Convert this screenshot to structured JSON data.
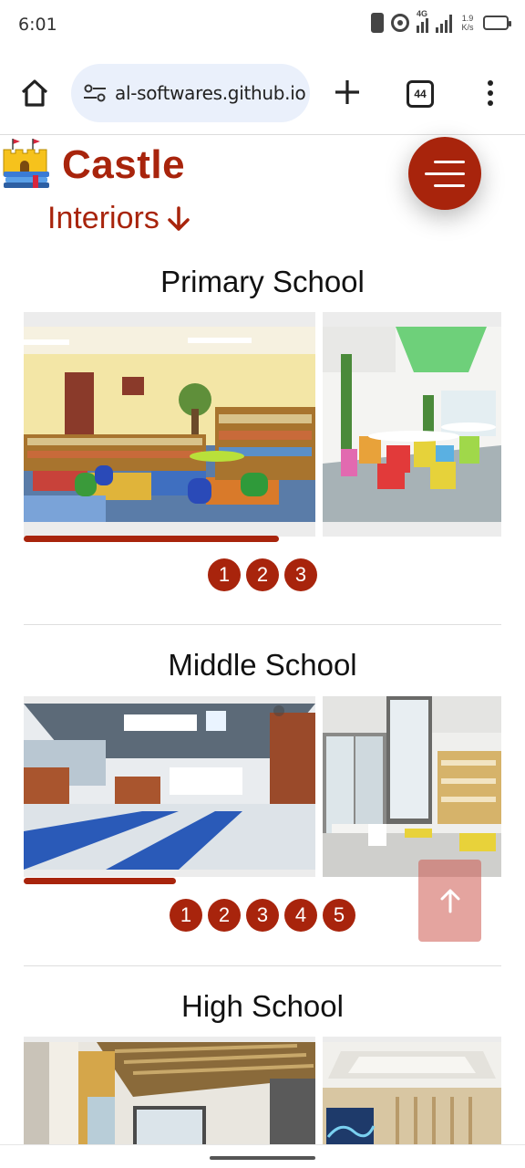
{
  "status_bar": {
    "time": "6:01",
    "network": "4G",
    "speed": "1.9 K/s"
  },
  "browser": {
    "url": "al-softwares.github.io",
    "tab_count": "44",
    "icons": [
      "home-icon",
      "site-settings-icon",
      "new-tab-icon",
      "tab-switcher-icon",
      "more-menu-icon"
    ]
  },
  "header": {
    "brand": "Castle",
    "tagline": "Interiors",
    "accent_color": "#a8240c",
    "icons": [
      "castle-logo-icon",
      "arrow-down-icon",
      "hamburger-menu-icon"
    ]
  },
  "sections": [
    {
      "title": "Primary School",
      "pages": [
        "1",
        "2",
        "3"
      ],
      "progress": 0.87,
      "images": [
        "classroom-library-image",
        "colorful-cafeteria-image"
      ]
    },
    {
      "title": "Middle School",
      "pages": [
        "1",
        "2",
        "3",
        "4",
        "5"
      ],
      "progress": 0.52,
      "images": [
        "locker-hallway-image",
        "lounge-seating-image"
      ]
    },
    {
      "title": "High School",
      "images": [
        "wood-ceiling-corridor-image",
        "atrium-ceiling-image"
      ]
    }
  ],
  "scroll_top": {
    "icon": "arrow-up-icon"
  }
}
